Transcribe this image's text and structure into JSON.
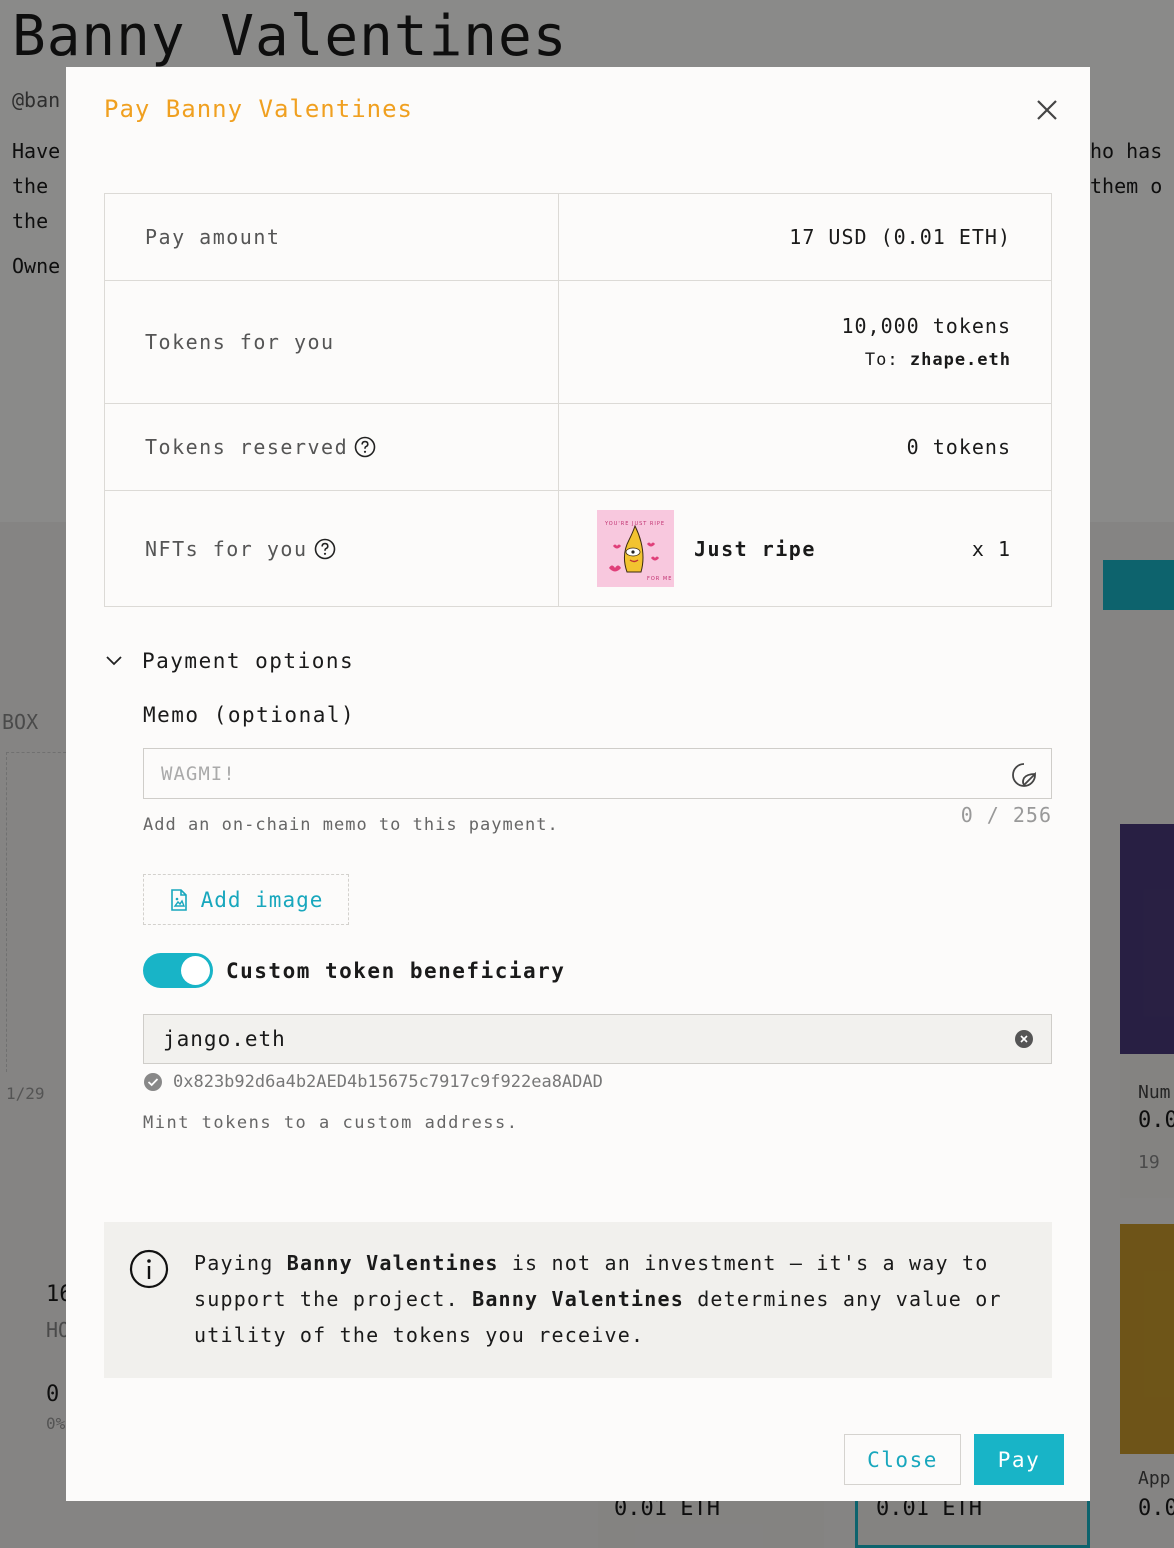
{
  "background": {
    "title": "Banny Valentines",
    "handle": "@ban",
    "desc_lines": [
      "Have",
      "the",
      "the"
    ],
    "owner": "Owne",
    "right_lines": [
      "ho has",
      "them o"
    ],
    "box_label": "BOX",
    "date_label": "1/29",
    "stat_1": "16",
    "stat_2": "HO",
    "stat_3": "0",
    "stat_4": "0%",
    "card_num_label": "Num",
    "card_num_value": "0.0",
    "card_count": "19",
    "card_app_label": "App",
    "card_app_value": "0.0",
    "tier_price_1": "0.01 ETH",
    "tier_price_2": "0.01 ETH"
  },
  "modal": {
    "title": "Pay Banny Valentines",
    "summary": {
      "pay_amount_label": "Pay amount",
      "pay_amount_value": "17 USD (0.01 ETH)",
      "tokens_for_you_label": "Tokens for you",
      "tokens_for_you_value": "10,000 tokens",
      "to_prefix": "To:",
      "to_address": "zhape.eth",
      "tokens_reserved_label": "Tokens reserved",
      "tokens_reserved_value": "0 tokens",
      "nfts_for_you_label": "NFTs for you",
      "nft_name": "Just ripe",
      "nft_quantity": "x 1",
      "nft_image_text_top": "YOU'RE JUST RIPE",
      "nft_image_text_bottom": "FOR ME"
    },
    "payment_options": {
      "label": "Payment options",
      "memo_label": "Memo (optional)",
      "memo_placeholder": "WAGMI!",
      "memo_value": "",
      "memo_help": "Add an on-chain memo to this payment.",
      "memo_count": "0 / 256",
      "add_image_label": "Add image",
      "custom_beneficiary_label": "Custom token beneficiary",
      "custom_beneficiary_enabled": true,
      "beneficiary_value": "jango.eth",
      "resolved_address": "0x823b92d6a4b2AED4b15675c7917c9f922ea8ADAD",
      "beneficiary_help": "Mint tokens to a custom address."
    },
    "disclaimer": {
      "prefix": "Paying",
      "project_1": "Banny Valentines",
      "middle": "is not an investment — it's a way to support the project.",
      "project_2": "Banny Valentines",
      "suffix": "determines any value or utility of the tokens you receive."
    },
    "buttons": {
      "close": "Close",
      "pay": "Pay"
    }
  },
  "colors": {
    "accent": "#18b4c7",
    "title": "#f0a020",
    "overlay": "rgba(0,0,0,0.45)"
  }
}
